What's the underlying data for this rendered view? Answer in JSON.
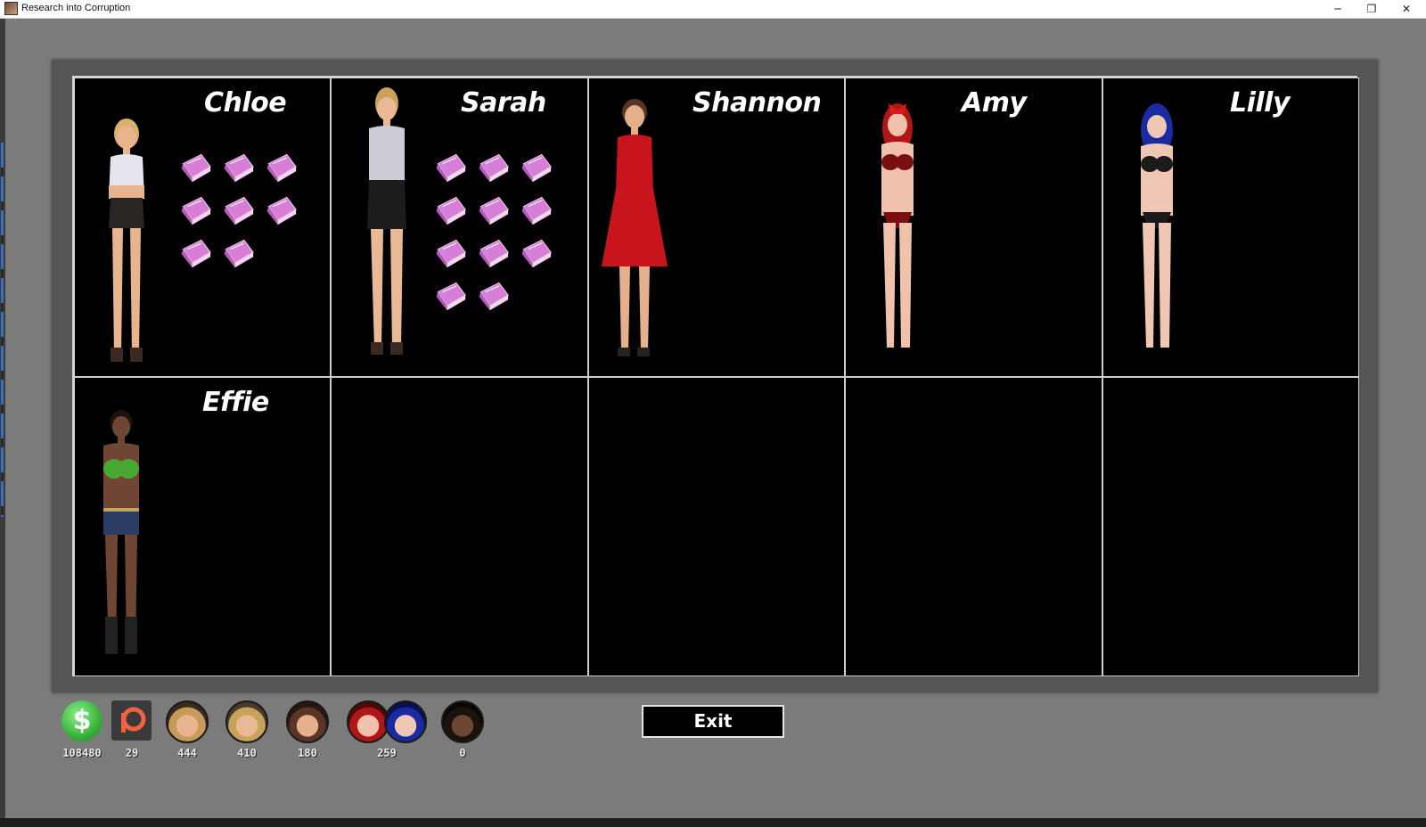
{
  "window": {
    "title": "Research into Corruption",
    "minimize_glyph": "─",
    "maximize_glyph": "❐",
    "close_glyph": "✕"
  },
  "characters": [
    {
      "name": "Chloe",
      "books": 8,
      "skin": "#e8b48e",
      "hair": "#d9b26a",
      "top": "#e7e3ec",
      "bottom": "#2a2522"
    },
    {
      "name": "Sarah",
      "books": 11,
      "skin": "#e9b894",
      "hair": "#c8a25a",
      "top": "#cfcbd6",
      "bottom": "#1c1c1c"
    },
    {
      "name": "Shannon",
      "books": 0,
      "skin": "#e7b08c",
      "hair": "#5a3424",
      "top": "#c8141c",
      "bottom": "#c8141c"
    },
    {
      "name": "Amy",
      "books": 0,
      "skin": "#f0c2ac",
      "hair": "#b01618",
      "top": "#7a0f12",
      "bottom": "#7a0f12"
    },
    {
      "name": "Lilly",
      "books": 0,
      "skin": "#f0c6b4",
      "hair": "#1a2aa0",
      "top": "#1b1b1b",
      "bottom": "#1b1b1b"
    },
    {
      "name": "Effie",
      "books": 0,
      "skin": "#6e4633",
      "hair": "#1a120c",
      "top": "#49a832",
      "bottom": "#2c3c62"
    }
  ],
  "stats": {
    "money": "108480",
    "patreon": "29",
    "chloe": "444",
    "sarah": "410",
    "shannon": "180",
    "amy_lilly": "259",
    "effie": "0",
    "money_icon_glyph": "$"
  },
  "buttons": {
    "exit_label": "Exit"
  },
  "colors": {
    "background": "#7b7b7b",
    "panel": "#555555",
    "grid_border": "#d6d6d6",
    "book": "#d77fd6"
  }
}
